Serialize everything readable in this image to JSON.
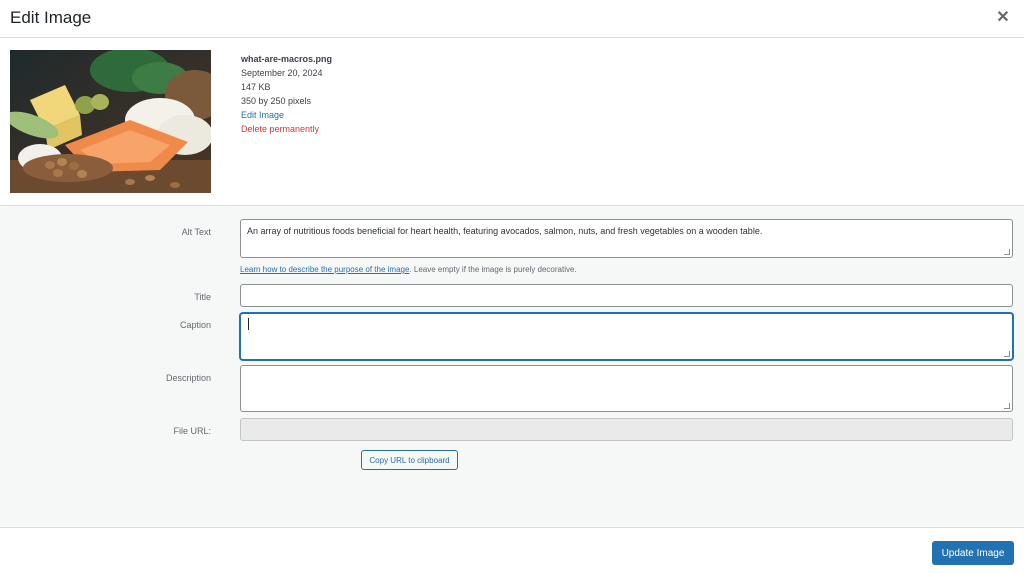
{
  "header": {
    "title": "Edit Image"
  },
  "details": {
    "filename": "what-are-macros.png",
    "date": "September 20, 2024",
    "filesize": "147 KB",
    "dimensions": "350 by 250 pixels",
    "edit_link": "Edit Image",
    "delete_link": "Delete permanently"
  },
  "form": {
    "alt_text": {
      "label": "Alt Text",
      "value": "An array of nutritious foods beneficial for heart health, featuring avocados, salmon, nuts, and fresh vegetables on a wooden table."
    },
    "help": {
      "link": "Learn how to describe the purpose of the image",
      "text": ". Leave empty if the image is purely decorative."
    },
    "title": {
      "label": "Title",
      "value": ""
    },
    "caption": {
      "label": "Caption",
      "value": ""
    },
    "description": {
      "label": "Description",
      "value": ""
    },
    "file_url": {
      "label": "File URL:",
      "value": ""
    },
    "copy_button": "Copy URL to clipboard"
  },
  "footer": {
    "update_button": "Update Image"
  },
  "colors": {
    "accent": "#2271b1",
    "danger": "#d63638"
  },
  "icons": {
    "close": "close-icon"
  }
}
